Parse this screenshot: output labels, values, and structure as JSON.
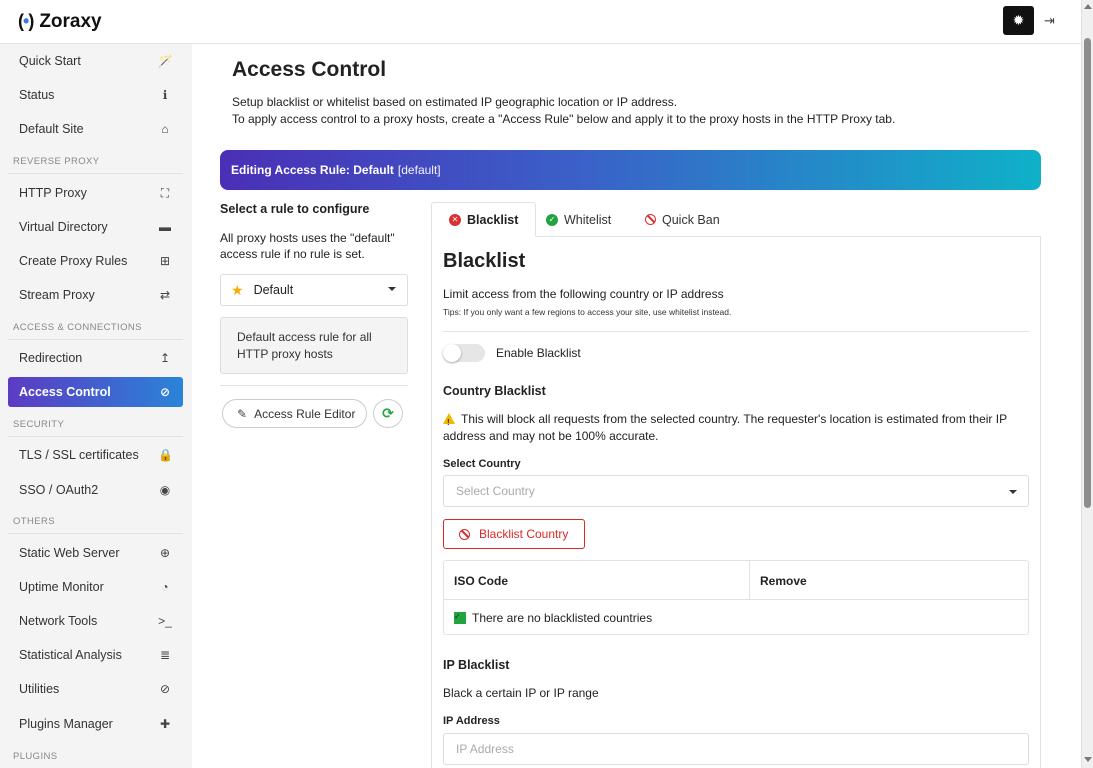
{
  "app": {
    "name": "Zoraxy",
    "logo_mark": "(·)"
  },
  "sidebar": {
    "items": [
      {
        "label": "Quick Start",
        "icon": "🪄"
      },
      {
        "label": "Status",
        "icon": "ℹ"
      },
      {
        "label": "Default Site",
        "icon": "⌂"
      },
      {
        "label": "HTTP Proxy",
        "icon": "⛶"
      },
      {
        "label": "Virtual Directory",
        "icon": "▬"
      },
      {
        "label": "Create Proxy Rules",
        "icon": "⊞"
      },
      {
        "label": "Stream Proxy",
        "icon": "⇄"
      },
      {
        "label": "Redirection",
        "icon": "↥"
      },
      {
        "label": "Access Control",
        "icon": "⊘"
      },
      {
        "label": "TLS / SSL certificates",
        "icon": "🔒"
      },
      {
        "label": "SSO / OAuth2",
        "icon": "◉"
      },
      {
        "label": "Static Web Server",
        "icon": "⊕"
      },
      {
        "label": "Uptime Monitor",
        "icon": "◔"
      },
      {
        "label": "Network Tools",
        "icon": ">_"
      },
      {
        "label": "Statistical Analysis",
        "icon": "≣"
      },
      {
        "label": "Utilities",
        "icon": "⊘"
      },
      {
        "label": "Plugins Manager",
        "icon": "✚"
      }
    ],
    "sections": {
      "reverse_proxy": "REVERSE PROXY",
      "access_connections": "ACCESS & CONNECTIONS",
      "security": "SECURITY",
      "others": "OTHERS",
      "plugins": "PLUGINS"
    }
  },
  "main": {
    "title": "Access Control",
    "desc_line1": "Setup blacklist or whitelist based on estimated IP geographic location or IP address.",
    "desc_line2": "To apply access control to a proxy hosts, create a \"Access Rule\" below and apply it to the proxy hosts in the HTTP Proxy tab.",
    "banner_prefix": "Editing Access Rule: Default",
    "banner_suffix": "[default]"
  },
  "rules": {
    "title": "Select a rule to configure",
    "note": "All proxy hosts uses the \"default\" access rule if no rule is set.",
    "selected": "Default",
    "selected_desc": "Default access rule for all HTTP proxy hosts",
    "editor_label": "Access Rule Editor"
  },
  "tabs": {
    "blacklist": "Blacklist",
    "whitelist": "Whitelist",
    "quickban": "Quick Ban"
  },
  "blacklist": {
    "heading": "Blacklist",
    "limit_text": "Limit access from the following country or IP address",
    "tips": "Tips: If you only want a few regions to access your site, use whitelist instead.",
    "toggle_label": "Enable Blacklist",
    "country_heading": "Country Blacklist",
    "country_warning": "This will block all requests from the selected country. The requester's location is estimated from their IP address and may not be 100% accurate.",
    "select_label": "Select Country",
    "select_placeholder": "Select Country",
    "button_label": "Blacklist Country",
    "table_headers": [
      "ISO Code",
      "Remove"
    ],
    "empty_text": "There are no blacklisted countries",
    "ip_heading": "IP Blacklist",
    "ip_text": "Black a certain IP or IP range",
    "ip_label": "IP Address",
    "ip_placeholder": "IP Address"
  },
  "colors": {
    "accent_gradient_start": "#4a2fb6",
    "accent_gradient_end": "#0fb1c8",
    "danger": "#db2828",
    "success": "#21a340",
    "warning": "#f2b700"
  }
}
